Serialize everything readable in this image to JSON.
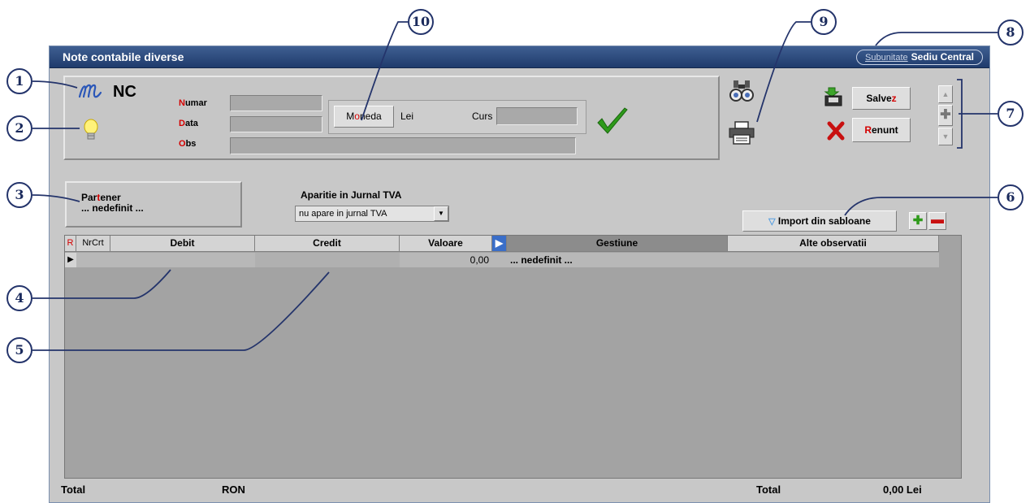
{
  "window": {
    "title": "Note contabile diverse"
  },
  "subunit": {
    "label": "Subunitate",
    "value": "Sediu Central"
  },
  "header": {
    "code": "NC",
    "fields": {
      "numar": {
        "first": "N",
        "rest": "umar"
      },
      "data": {
        "first": "D",
        "rest": "ata"
      },
      "obs": {
        "first": "O",
        "rest": "bs"
      }
    },
    "moneda_button": {
      "pre": "M",
      "accent": "o",
      "post": "neda"
    },
    "moneda_value": "Lei",
    "curs_label": "Curs"
  },
  "buttons": {
    "save": {
      "pre": "Salve",
      "accent": "z"
    },
    "cancel": {
      "accent": "R",
      "post": "enunt"
    }
  },
  "partner": {
    "pre": "Par",
    "accent": "t",
    "post": "ener",
    "value": "... nedefinit ..."
  },
  "jurnal": {
    "label": "Aparitie in Jurnal TVA",
    "selected": "nu apare in jurnal TVA"
  },
  "import_button": "Import din sabloane",
  "table": {
    "columns": [
      "R",
      "NrCrt",
      "Debit",
      "Credit",
      "Valoare",
      "Gestiune",
      "Alte observatii"
    ],
    "rows": [
      {
        "valoare": "0,00",
        "gestiune": "... nedefinit ..."
      }
    ]
  },
  "footer": {
    "total_label": "Total",
    "currency": "RON",
    "total_label2": "Total",
    "total_value": "0,00 Lei"
  },
  "callouts": [
    "1",
    "2",
    "3",
    "4",
    "5",
    "6",
    "7",
    "8",
    "9",
    "10"
  ],
  "colors": {
    "title_bar": "#1f3b6c",
    "accent_red": "#d40000",
    "check_green": "#2e9a1a",
    "callout_border": "#24346b"
  },
  "icons": [
    "m-logo-icon",
    "lightbulb-icon",
    "binoculars-icon",
    "printer-icon",
    "save-disk-icon",
    "cancel-x-icon",
    "checkmark-icon",
    "arrow-up-icon",
    "plus-icon",
    "arrow-down-icon",
    "add-row-icon",
    "remove-row-icon",
    "row-pointer-icon"
  ]
}
